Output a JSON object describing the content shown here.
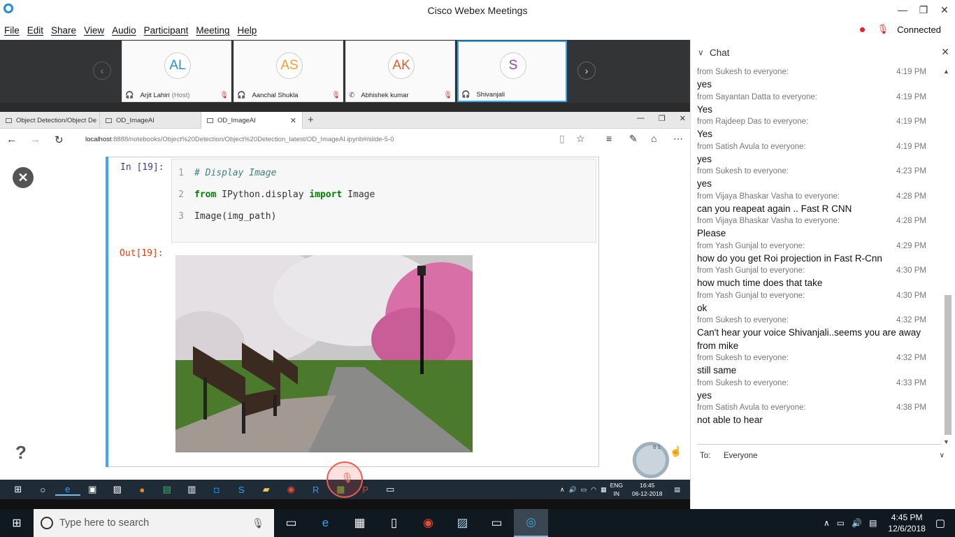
{
  "window": {
    "title": "Cisco Webex Meetings",
    "minimize": "—",
    "restore": "❐",
    "close": "✕"
  },
  "menu": {
    "items": [
      "File",
      "Edit",
      "Share",
      "View",
      "Audio",
      "Participant",
      "Meeting",
      "Help"
    ],
    "status": "Connected"
  },
  "participants": [
    {
      "initials": "AL",
      "name": "Arjit Lahiri",
      "role": "(Host)",
      "color": "#2a8fd0"
    },
    {
      "initials": "AS",
      "name": "Aanchal Shukla",
      "role": "",
      "color": "#f0a030"
    },
    {
      "initials": "AK",
      "name": "Abhishek kumar",
      "role": "",
      "color": "#e85a2a"
    },
    {
      "initials": "S",
      "name": "Shivanjali",
      "role": "",
      "color": "#9a3ea8"
    }
  ],
  "browser": {
    "tabs": [
      "Object Detection/Object De",
      "OD_ImageAI",
      "OD_ImageAI"
    ],
    "url_host": "localhost",
    "url_rest": ":8888/notebooks/Object%20Detection/Object%20Detection_latest/OD_ImageAI.ipynb#/slide-5-0"
  },
  "notebook": {
    "in_prompt": "In [19]:",
    "out_prompt": "Out[19]:",
    "lines": [
      {
        "n": "1",
        "parts": [
          {
            "t": "# Display Image",
            "c": "cmt"
          }
        ]
      },
      {
        "n": "2",
        "parts": [
          {
            "t": "from",
            "c": "kw"
          },
          {
            "t": " IPython.display ",
            "c": ""
          },
          {
            "t": "import",
            "c": "kw"
          },
          {
            "t": " Image",
            "c": ""
          }
        ]
      },
      {
        "n": "3",
        "parts": [
          {
            "t": "Image(img_path)",
            "c": ""
          }
        ]
      }
    ],
    "help": "?",
    "spinner_text": "6  1"
  },
  "inner_taskbar": {
    "lang1": "ENG",
    "lang2": "IN",
    "time": "16:45",
    "date": "06-12-2018"
  },
  "chat": {
    "title": "Chat",
    "messages": [
      {
        "from": "from Sukesh to everyone:",
        "time": "4:19 PM",
        "text": "yes"
      },
      {
        "from": "from Sayantan Datta to everyone:",
        "time": "4:19 PM",
        "text": "Yes"
      },
      {
        "from": "from Rajdeep Das to everyone:",
        "time": "4:19 PM",
        "text": "Yes"
      },
      {
        "from": "from Satish Avula to everyone:",
        "time": "4:19 PM",
        "text": "yes"
      },
      {
        "from": "from Sukesh to everyone:",
        "time": "4:23 PM",
        "text": "yes"
      },
      {
        "from": "from Vijaya Bhaskar Vasha to everyone:",
        "time": "4:28 PM",
        "text": "can you reapeat again ..  Fast R CNN"
      },
      {
        "from": "from Vijaya Bhaskar Vasha to everyone:",
        "time": "4:28 PM",
        "text": "Please"
      },
      {
        "from": "from Yash Gunjal to everyone:",
        "time": "4:29 PM",
        "text": "how do you get Roi projection in Fast R-Cnn"
      },
      {
        "from": "from Yash Gunjal to everyone:",
        "time": "4:30 PM",
        "text": "how much time does that take"
      },
      {
        "from": "from Yash Gunjal to everyone:",
        "time": "4:30 PM",
        "text": "ok"
      },
      {
        "from": "from Sukesh to everyone:",
        "time": "4:32 PM",
        "text": "Can't hear your voice Shivanjali..seems you are away from mike"
      },
      {
        "from": "from Sukesh to everyone:",
        "time": "4:32 PM",
        "text": "still same"
      },
      {
        "from": "from Sukesh to everyone:",
        "time": "4:33 PM",
        "text": "yes"
      },
      {
        "from": "from Satish Avula to everyone:",
        "time": "4:38 PM",
        "text": "not able to hear"
      }
    ],
    "to_label": "To:",
    "to_value": "Everyone"
  },
  "taskbar": {
    "search_placeholder": "Type here to search",
    "time": "4:45 PM",
    "date": "12/6/2018"
  }
}
